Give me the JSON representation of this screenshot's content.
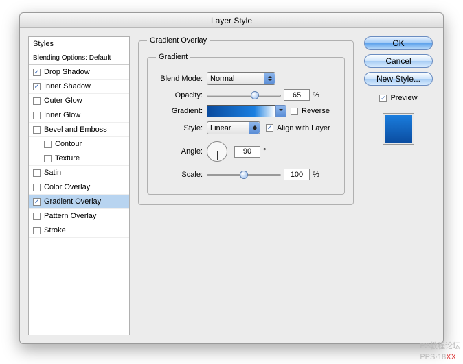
{
  "window": {
    "title": "Layer Style"
  },
  "styles": {
    "header": "Styles",
    "subheader": "Blending Options: Default",
    "items": [
      {
        "label": "Drop Shadow",
        "checked": true,
        "selected": false,
        "indent": false
      },
      {
        "label": "Inner Shadow",
        "checked": true,
        "selected": false,
        "indent": false
      },
      {
        "label": "Outer Glow",
        "checked": false,
        "selected": false,
        "indent": false
      },
      {
        "label": "Inner Glow",
        "checked": false,
        "selected": false,
        "indent": false
      },
      {
        "label": "Bevel and Emboss",
        "checked": false,
        "selected": false,
        "indent": false
      },
      {
        "label": "Contour",
        "checked": false,
        "selected": false,
        "indent": true
      },
      {
        "label": "Texture",
        "checked": false,
        "selected": false,
        "indent": true
      },
      {
        "label": "Satin",
        "checked": false,
        "selected": false,
        "indent": false
      },
      {
        "label": "Color Overlay",
        "checked": false,
        "selected": false,
        "indent": false
      },
      {
        "label": "Gradient Overlay",
        "checked": true,
        "selected": true,
        "indent": false
      },
      {
        "label": "Pattern Overlay",
        "checked": false,
        "selected": false,
        "indent": false
      },
      {
        "label": "Stroke",
        "checked": false,
        "selected": false,
        "indent": false
      }
    ]
  },
  "panel": {
    "title": "Gradient Overlay",
    "subtitle": "Gradient",
    "blend_mode": {
      "label": "Blend Mode:",
      "value": "Normal"
    },
    "opacity": {
      "label": "Opacity:",
      "value": "65",
      "unit": "%",
      "thumb_pct": 65
    },
    "gradient": {
      "label": "Gradient:",
      "reverse_label": "Reverse",
      "reverse_checked": false
    },
    "style": {
      "label": "Style:",
      "value": "Linear",
      "align_label": "Align with Layer",
      "align_checked": true
    },
    "angle": {
      "label": "Angle:",
      "value": "90",
      "unit": "°"
    },
    "scale": {
      "label": "Scale:",
      "value": "100",
      "unit": "%",
      "thumb_pct": 50
    }
  },
  "buttons": {
    "ok": "OK",
    "cancel": "Cancel",
    "new_style": "New Style...",
    "preview": "Preview",
    "preview_checked": true
  },
  "watermark": {
    "text1": "PS教程论坛",
    "text2": "PPS·18",
    "text3": "XX"
  }
}
